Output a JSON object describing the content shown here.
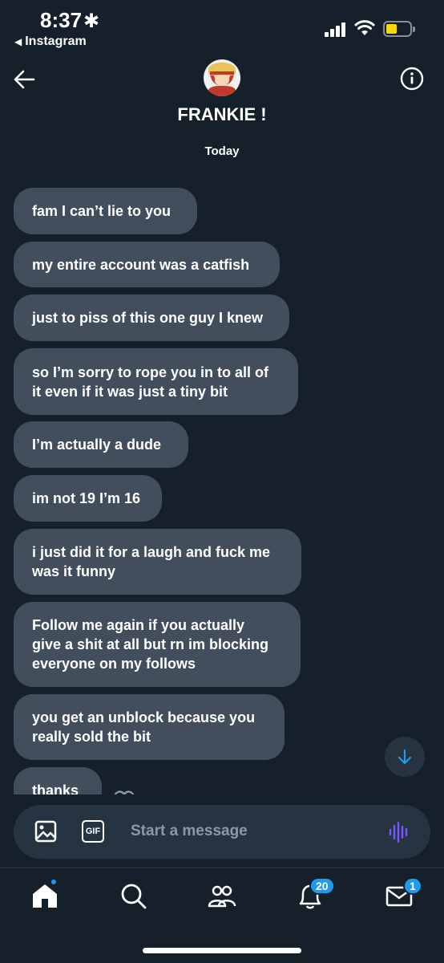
{
  "status_bar": {
    "time": "8:37",
    "time_suffix": "✱",
    "back_app": "Instagram",
    "battery_color": "#f5d90a"
  },
  "header": {
    "contact_name": "FRANKIE !",
    "date_label": "Today",
    "back_icon": "arrow-left-icon",
    "info_icon": "info-circle-icon"
  },
  "messages": [
    {
      "text": "fam I can’t lie to you"
    },
    {
      "text": "my entire account was a catfish"
    },
    {
      "text": "just to piss of this one guy I knew"
    },
    {
      "text": "so I’m sorry to rope you in to all of\nit even if it was just a tiny bit"
    },
    {
      "text": "I’m actually a dude"
    },
    {
      "text": "im not 19 I’m 16"
    },
    {
      "text": "i just did it for a laugh and fuck me\nwas it funny"
    },
    {
      "text": "Follow me again if you actually\ngive a shit at all but rn im blocking\neveryone on my follows"
    },
    {
      "text": "you get an unblock because you\nreally sold the bit"
    },
    {
      "text": "thanks"
    }
  ],
  "composer": {
    "placeholder": "Start a message",
    "gif_label": "GIF",
    "image_icon": "image-icon",
    "voice_icon": "voice-waveform-icon",
    "voice_color": "#7856ff"
  },
  "tab_bar": {
    "items": [
      {
        "name": "home",
        "icon": "home-icon"
      },
      {
        "name": "search",
        "icon": "search-icon"
      },
      {
        "name": "communities",
        "icon": "people-icon"
      },
      {
        "name": "notifications",
        "icon": "bell-icon",
        "badge": "20"
      },
      {
        "name": "messages",
        "icon": "envelope-icon",
        "badge": "1"
      }
    ],
    "accent": "#1d9bf0"
  },
  "colors": {
    "background": "#15202b",
    "bubble": "#424e5c"
  }
}
